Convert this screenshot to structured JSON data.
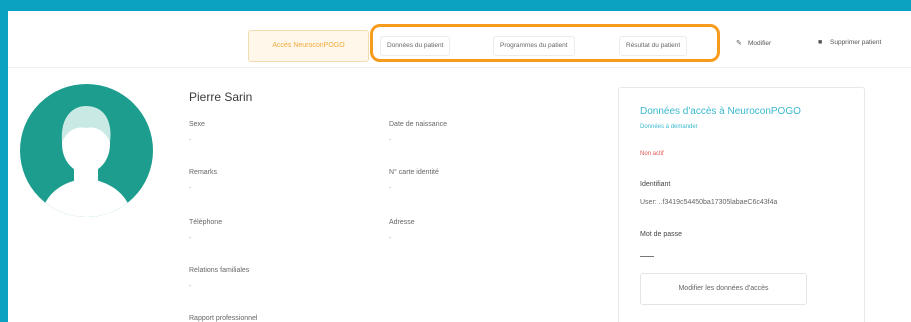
{
  "toolbar": {
    "active_button": "Accès NeuroconPOGO",
    "tabs": [
      "Données du patient",
      "Programmes du patient",
      "Résultat du patient"
    ],
    "edit_label": "Modifier",
    "delete_label": "Supprimer patient",
    "edit_icon": "pencil-icon",
    "delete_icon": "trash-icon"
  },
  "profile": {
    "name": "Pierre Sarin",
    "fields": [
      {
        "label": "Sexe",
        "value": "-"
      },
      {
        "label": "Date de naissance",
        "value": "-"
      },
      {
        "label": "Remarks",
        "value": "-"
      },
      {
        "label": "N° carte identité",
        "value": "-"
      },
      {
        "label": "Téléphone",
        "value": "-"
      },
      {
        "label": "Adresse",
        "value": "-"
      },
      {
        "label": "Relations familiales",
        "value": "-"
      },
      {
        "label": "Rapport professionnel",
        "value": ""
      }
    ]
  },
  "access_panel": {
    "title": "Données d'accès à NeuroconPOGO",
    "subtitle": "Données à demander",
    "status": "Non actif",
    "identifier_label": "Identifiant",
    "identifier_value": "User: ..f3419c54450ba17305labaeC6c43f4a",
    "password_label": "Mot de passe",
    "button_label": "Modifier les données d'accès"
  },
  "colors": {
    "background": "#0aa2c0",
    "highlight_border": "#f79b1d",
    "accent": "#3bb8cf",
    "avatar": "#1c9d8e",
    "status_inactive": "#e0554f"
  }
}
